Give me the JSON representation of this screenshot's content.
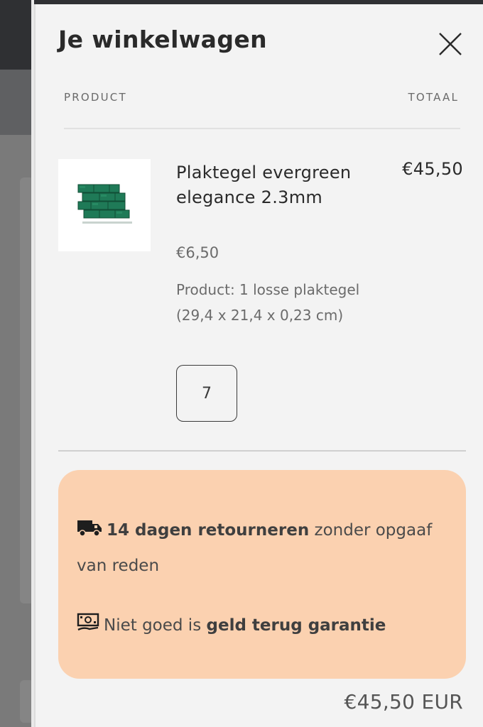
{
  "cart": {
    "title": "Je winkelwagen",
    "close_icon": "close-icon",
    "columns": {
      "product": "PRODUCT",
      "total": "TOTAAL"
    },
    "item": {
      "name": "Plaktegel evergreen elegance 2.3mm",
      "line_total": "€45,50",
      "unit_price": "€6,50",
      "variant": "Product: 1 losse plaktegel (29,4 x 21,4 x 0,23 cm)",
      "quantity": "7",
      "image_icon": "green-tile-thumbnail"
    },
    "promo": {
      "background": "#fbd1b0",
      "returns_icon": "truck-icon",
      "returns_bold": "14 dagen retourneren",
      "returns_rest": " zonder opgaaf van reden",
      "guarantee_icon": "cash-icon",
      "guarantee_prefix": "Niet goed is ",
      "guarantee_bold": "geld terug garantie"
    },
    "grand_total": "€45,50 EUR"
  }
}
